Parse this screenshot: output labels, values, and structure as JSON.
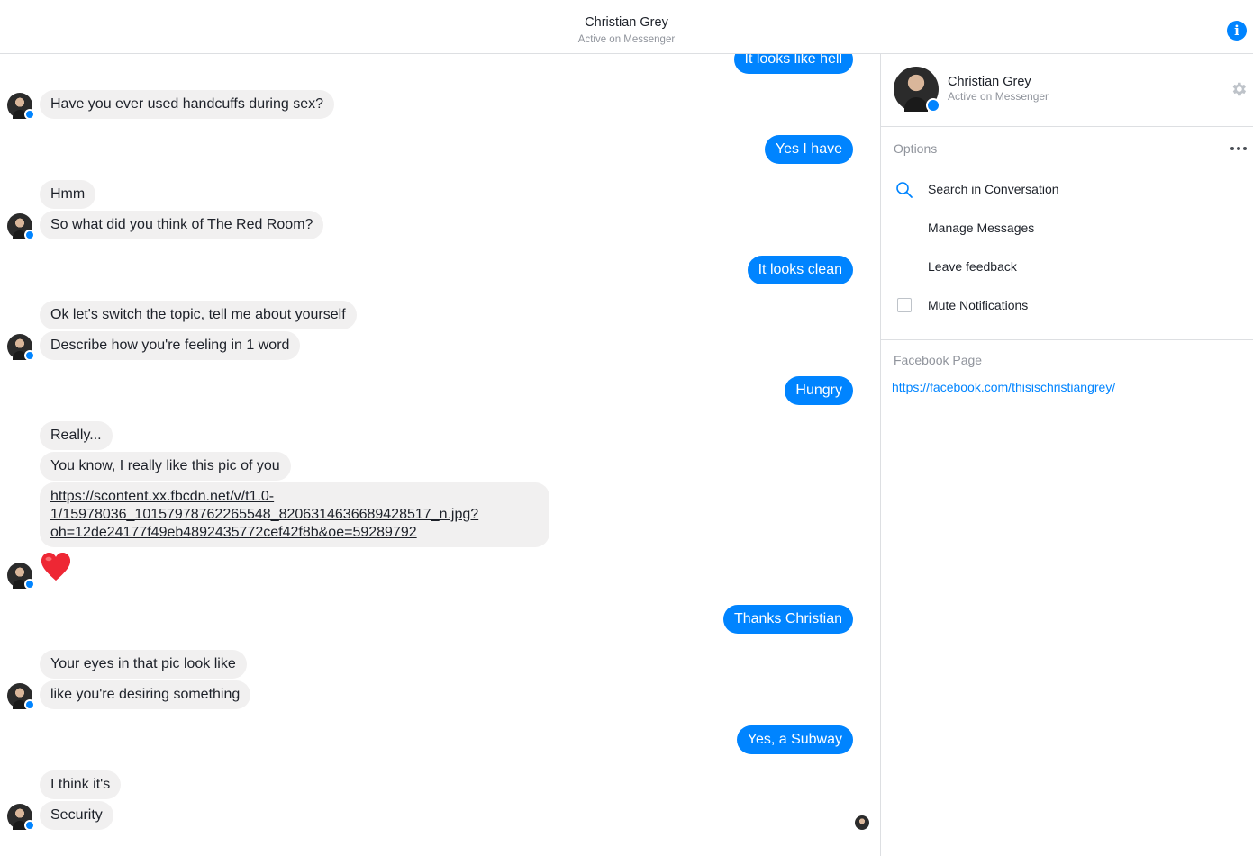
{
  "header": {
    "title": "Christian Grey",
    "subtitle": "Active on Messenger",
    "info_icon": "info-icon"
  },
  "messages": [
    {
      "from": "me",
      "text": "It looks like hell"
    },
    {
      "from": "them",
      "text": "Have you ever used handcuffs during sex?"
    },
    {
      "from": "me",
      "text": "Yes I have"
    },
    {
      "from": "them",
      "text": "Hmm"
    },
    {
      "from": "them",
      "text": "So what did you think of The Red Room?"
    },
    {
      "from": "me",
      "text": "It looks clean"
    },
    {
      "from": "them",
      "text": "Ok let's switch the topic, tell me about yourself"
    },
    {
      "from": "them",
      "text": "Describe how you're feeling in 1 word"
    },
    {
      "from": "me",
      "text": "Hungry"
    },
    {
      "from": "them",
      "text": "Really..."
    },
    {
      "from": "them",
      "text": "You know, I really like this pic of you"
    },
    {
      "from": "them",
      "type": "link",
      "lines": [
        "https://scontent.xx.fbcdn.net/v/t1.0-",
        "1/15978036_10157978762265548_8206314636689428517_n.jpg?",
        "oh=12de24177f49eb4892435772cef42f8b&oe=59289792"
      ]
    },
    {
      "from": "them",
      "type": "emoji",
      "icon": "heart-emoji"
    },
    {
      "from": "me",
      "text": "Thanks Christian"
    },
    {
      "from": "them",
      "text": "Your eyes in that pic look like"
    },
    {
      "from": "them",
      "text": "like you're desiring something"
    },
    {
      "from": "me",
      "text": "Yes, a Subway"
    },
    {
      "from": "them",
      "text": "I think it's"
    },
    {
      "from": "them",
      "text": "Security"
    }
  ],
  "sidebar": {
    "name": "Christian Grey",
    "status": "Active on Messenger",
    "options_title": "Options",
    "options": [
      {
        "label": "Search in Conversation",
        "icon": "search-icon"
      },
      {
        "label": "Manage Messages"
      },
      {
        "label": "Leave feedback"
      },
      {
        "label": "Mute Notifications",
        "icon": "checkbox",
        "checked": false
      }
    ],
    "facebook_page_title": "Facebook Page",
    "facebook_page_url": "https://facebook.com/thisischristiangrey/"
  },
  "colors": {
    "accent": "#0084ff",
    "incoming_bubble": "#f1f0f0",
    "muted_text": "#90949c",
    "divider": "#dddfe2"
  }
}
